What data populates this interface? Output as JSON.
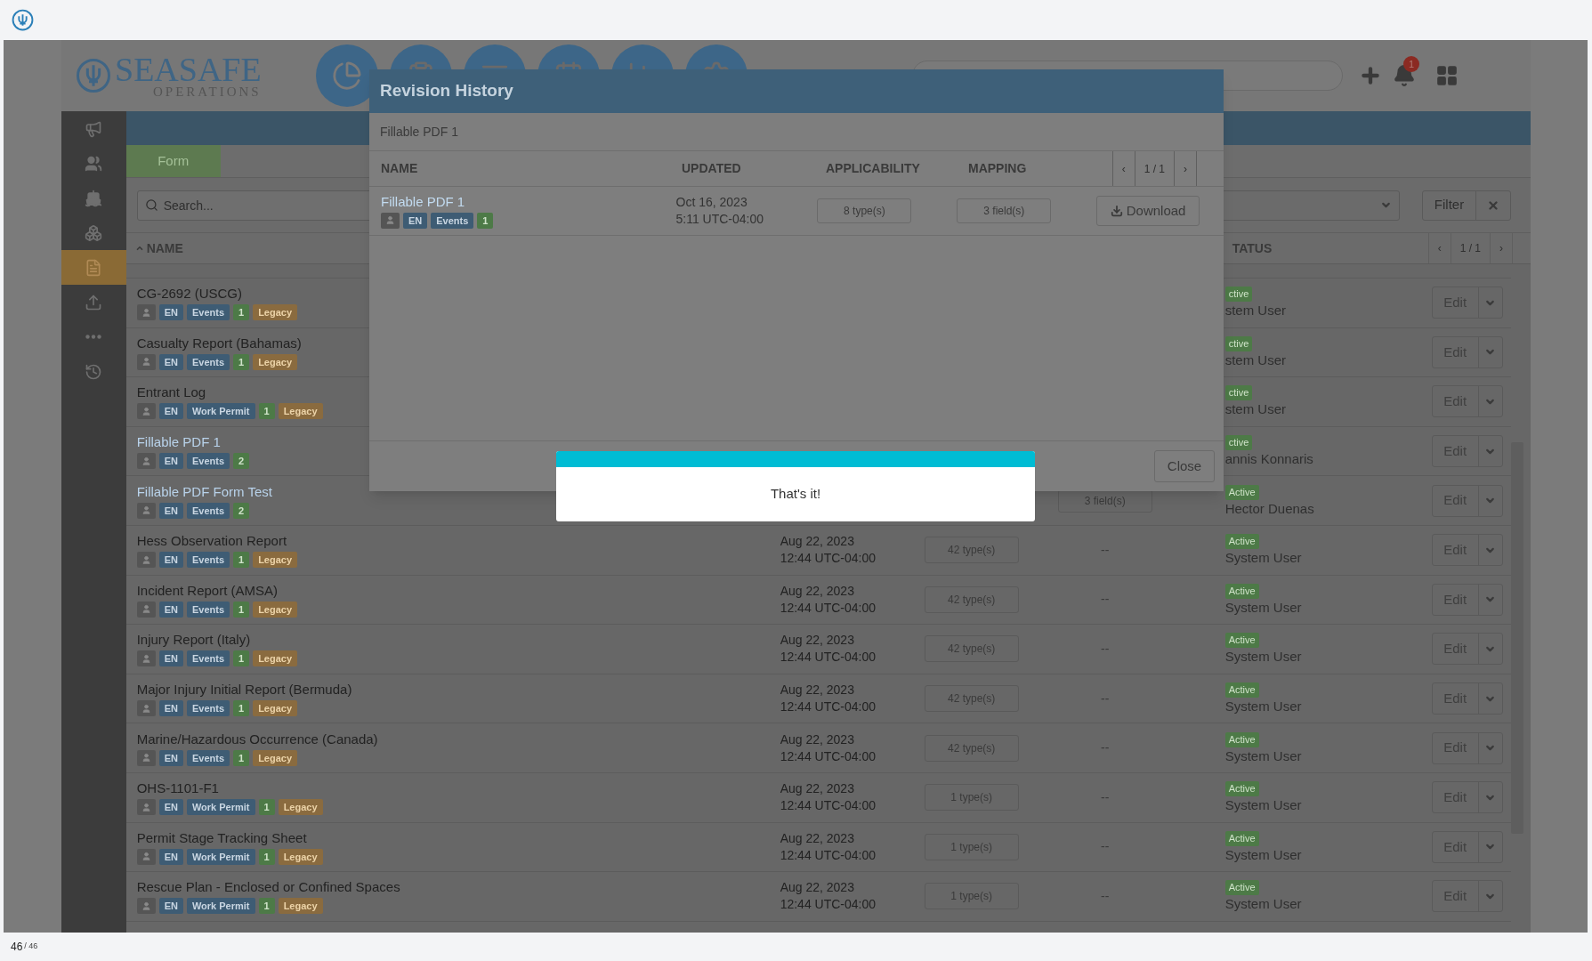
{
  "app_header": {
    "logo_name": "SEASAFE",
    "logo_sub": "OPERATIONS",
    "notification_count": "1"
  },
  "sidebar": {
    "items": [
      {
        "selected": false
      },
      {
        "selected": false
      },
      {
        "selected": false
      },
      {
        "selected": false
      },
      {
        "selected": true
      },
      {
        "selected": false
      },
      {
        "selected": false
      },
      {
        "selected": false
      }
    ]
  },
  "tabs": [
    {
      "label": "Form",
      "selected": true
    }
  ],
  "search": {
    "placeholder": "Search..."
  },
  "filter_button": "Filter",
  "table": {
    "columns": [
      "NAME",
      "TATUS"
    ],
    "pager": {
      "prev": "‹",
      "page": "1 / 1",
      "next": "›"
    },
    "rows": [
      {
        "name": "CG-2692 (USCG)",
        "link": false,
        "tags": [
          {
            "kind": "user"
          },
          {
            "kind": "lang",
            "text": "EN"
          },
          {
            "kind": "category",
            "text": "Events"
          },
          {
            "kind": "count",
            "text": "1"
          },
          {
            "kind": "legacy",
            "text": "Legacy"
          }
        ],
        "status": "ctive",
        "user": "stem User",
        "action": "Edit"
      },
      {
        "name": "Casualty Report (Bahamas)",
        "link": false,
        "tags": [
          {
            "kind": "user"
          },
          {
            "kind": "lang",
            "text": "EN"
          },
          {
            "kind": "category",
            "text": "Events"
          },
          {
            "kind": "count",
            "text": "1"
          },
          {
            "kind": "legacy",
            "text": "Legacy"
          }
        ],
        "status": "ctive",
        "user": "stem User",
        "action": "Edit"
      },
      {
        "name": "Entrant Log",
        "link": false,
        "tags": [
          {
            "kind": "user"
          },
          {
            "kind": "lang",
            "text": "EN"
          },
          {
            "kind": "category",
            "text": "Work Permit"
          },
          {
            "kind": "count",
            "text": "1"
          },
          {
            "kind": "legacy",
            "text": "Legacy"
          }
        ],
        "status": "ctive",
        "user": "stem User",
        "action": "Edit"
      },
      {
        "name": "Fillable PDF 1",
        "link": true,
        "tags": [
          {
            "kind": "user"
          },
          {
            "kind": "lang",
            "text": "EN"
          },
          {
            "kind": "category",
            "text": "Events"
          },
          {
            "kind": "count",
            "text": "2"
          }
        ],
        "status": "ctive",
        "user": "annis Konnaris",
        "action": "Edit"
      },
      {
        "name": "Fillable PDF Form Test",
        "link": true,
        "tags": [
          {
            "kind": "user"
          },
          {
            "kind": "lang",
            "text": "EN"
          },
          {
            "kind": "category",
            "text": "Events"
          },
          {
            "kind": "count",
            "text": "2"
          }
        ],
        "mapping": "3 field(s)",
        "status": "Active",
        "user": "Hector Duenas",
        "action": "Edit"
      },
      {
        "name": "Hess Observation Report",
        "link": false,
        "tags": [
          {
            "kind": "user"
          },
          {
            "kind": "lang",
            "text": "EN"
          },
          {
            "kind": "category",
            "text": "Events"
          },
          {
            "kind": "count",
            "text": "1"
          },
          {
            "kind": "legacy",
            "text": "Legacy"
          }
        ],
        "updated": [
          "Aug 22, 2023",
          "12:44 UTC-04:00"
        ],
        "applicability": "42 type(s)",
        "mapping": "--",
        "status": "Active",
        "user": "System User",
        "action": "Edit"
      },
      {
        "name": "Incident Report (AMSA)",
        "link": false,
        "tags": [
          {
            "kind": "user"
          },
          {
            "kind": "lang",
            "text": "EN"
          },
          {
            "kind": "category",
            "text": "Events"
          },
          {
            "kind": "count",
            "text": "1"
          },
          {
            "kind": "legacy",
            "text": "Legacy"
          }
        ],
        "updated": [
          "Aug 22, 2023",
          "12:44 UTC-04:00"
        ],
        "applicability": "42 type(s)",
        "mapping": "--",
        "status": "Active",
        "user": "System User",
        "action": "Edit"
      },
      {
        "name": "Injury Report (Italy)",
        "link": false,
        "tags": [
          {
            "kind": "user"
          },
          {
            "kind": "lang",
            "text": "EN"
          },
          {
            "kind": "category",
            "text": "Events"
          },
          {
            "kind": "count",
            "text": "1"
          },
          {
            "kind": "legacy",
            "text": "Legacy"
          }
        ],
        "updated": [
          "Aug 22, 2023",
          "12:44 UTC-04:00"
        ],
        "applicability": "42 type(s)",
        "mapping": "--",
        "status": "Active",
        "user": "System User",
        "action": "Edit"
      },
      {
        "name": "Major Injury Initial Report (Bermuda)",
        "link": false,
        "tags": [
          {
            "kind": "user"
          },
          {
            "kind": "lang",
            "text": "EN"
          },
          {
            "kind": "category",
            "text": "Events"
          },
          {
            "kind": "count",
            "text": "1"
          },
          {
            "kind": "legacy",
            "text": "Legacy"
          }
        ],
        "updated": [
          "Aug 22, 2023",
          "12:44 UTC-04:00"
        ],
        "applicability": "42 type(s)",
        "mapping": "--",
        "status": "Active",
        "user": "System User",
        "action": "Edit"
      },
      {
        "name": "Marine/Hazardous Occurrence (Canada)",
        "link": false,
        "tags": [
          {
            "kind": "user"
          },
          {
            "kind": "lang",
            "text": "EN"
          },
          {
            "kind": "category",
            "text": "Events"
          },
          {
            "kind": "count",
            "text": "1"
          },
          {
            "kind": "legacy",
            "text": "Legacy"
          }
        ],
        "updated": [
          "Aug 22, 2023",
          "12:44 UTC-04:00"
        ],
        "applicability": "42 type(s)",
        "mapping": "--",
        "status": "Active",
        "user": "System User",
        "action": "Edit"
      },
      {
        "name": "OHS-1101-F1",
        "link": false,
        "tags": [
          {
            "kind": "user"
          },
          {
            "kind": "lang",
            "text": "EN"
          },
          {
            "kind": "category",
            "text": "Work Permit"
          },
          {
            "kind": "count",
            "text": "1"
          },
          {
            "kind": "legacy",
            "text": "Legacy"
          }
        ],
        "updated": [
          "Aug 22, 2023",
          "12:44 UTC-04:00"
        ],
        "applicability": "1 type(s)",
        "mapping": "--",
        "status": "Active",
        "user": "System User",
        "action": "Edit"
      },
      {
        "name": "Permit Stage Tracking Sheet",
        "link": false,
        "tags": [
          {
            "kind": "user"
          },
          {
            "kind": "lang",
            "text": "EN"
          },
          {
            "kind": "category",
            "text": "Work Permit"
          },
          {
            "kind": "count",
            "text": "1"
          },
          {
            "kind": "legacy",
            "text": "Legacy"
          }
        ],
        "updated": [
          "Aug 22, 2023",
          "12:44 UTC-04:00"
        ],
        "applicability": "1 type(s)",
        "mapping": "--",
        "status": "Active",
        "user": "System User",
        "action": "Edit"
      },
      {
        "name": "Rescue Plan - Enclosed or Confined Spaces",
        "link": false,
        "tags": [
          {
            "kind": "user"
          },
          {
            "kind": "lang",
            "text": "EN"
          },
          {
            "kind": "category",
            "text": "Work Permit"
          },
          {
            "kind": "count",
            "text": "1"
          },
          {
            "kind": "legacy",
            "text": "Legacy"
          }
        ],
        "updated": [
          "Aug 22, 2023",
          "12:44 UTC-04:00"
        ],
        "applicability": "1 type(s)",
        "mapping": "--",
        "status": "Active",
        "user": "System User",
        "action": "Edit"
      }
    ]
  },
  "modal": {
    "title": "Revision History",
    "subtitle": "Fillable PDF 1",
    "columns": [
      "NAME",
      "UPDATED",
      "APPLICABILITY",
      "MAPPING"
    ],
    "pager": {
      "prev": "‹",
      "page": "1 / 1",
      "next": "›"
    },
    "rows": [
      {
        "name": "Fillable PDF 1",
        "link": true,
        "tags": [
          {
            "kind": "user"
          },
          {
            "kind": "lang",
            "text": "EN"
          },
          {
            "kind": "category",
            "text": "Events"
          },
          {
            "kind": "count",
            "text": "1"
          }
        ],
        "updated": [
          "Oct 16, 2023",
          "5:11 UTC-04:00"
        ],
        "applicability": "8 type(s)",
        "mapping": "3 field(s)",
        "action": "Download"
      }
    ],
    "close_button": "Close"
  },
  "toast": {
    "message": "That's it!"
  },
  "page_counter": {
    "current": "46",
    "total": "/ 46"
  }
}
